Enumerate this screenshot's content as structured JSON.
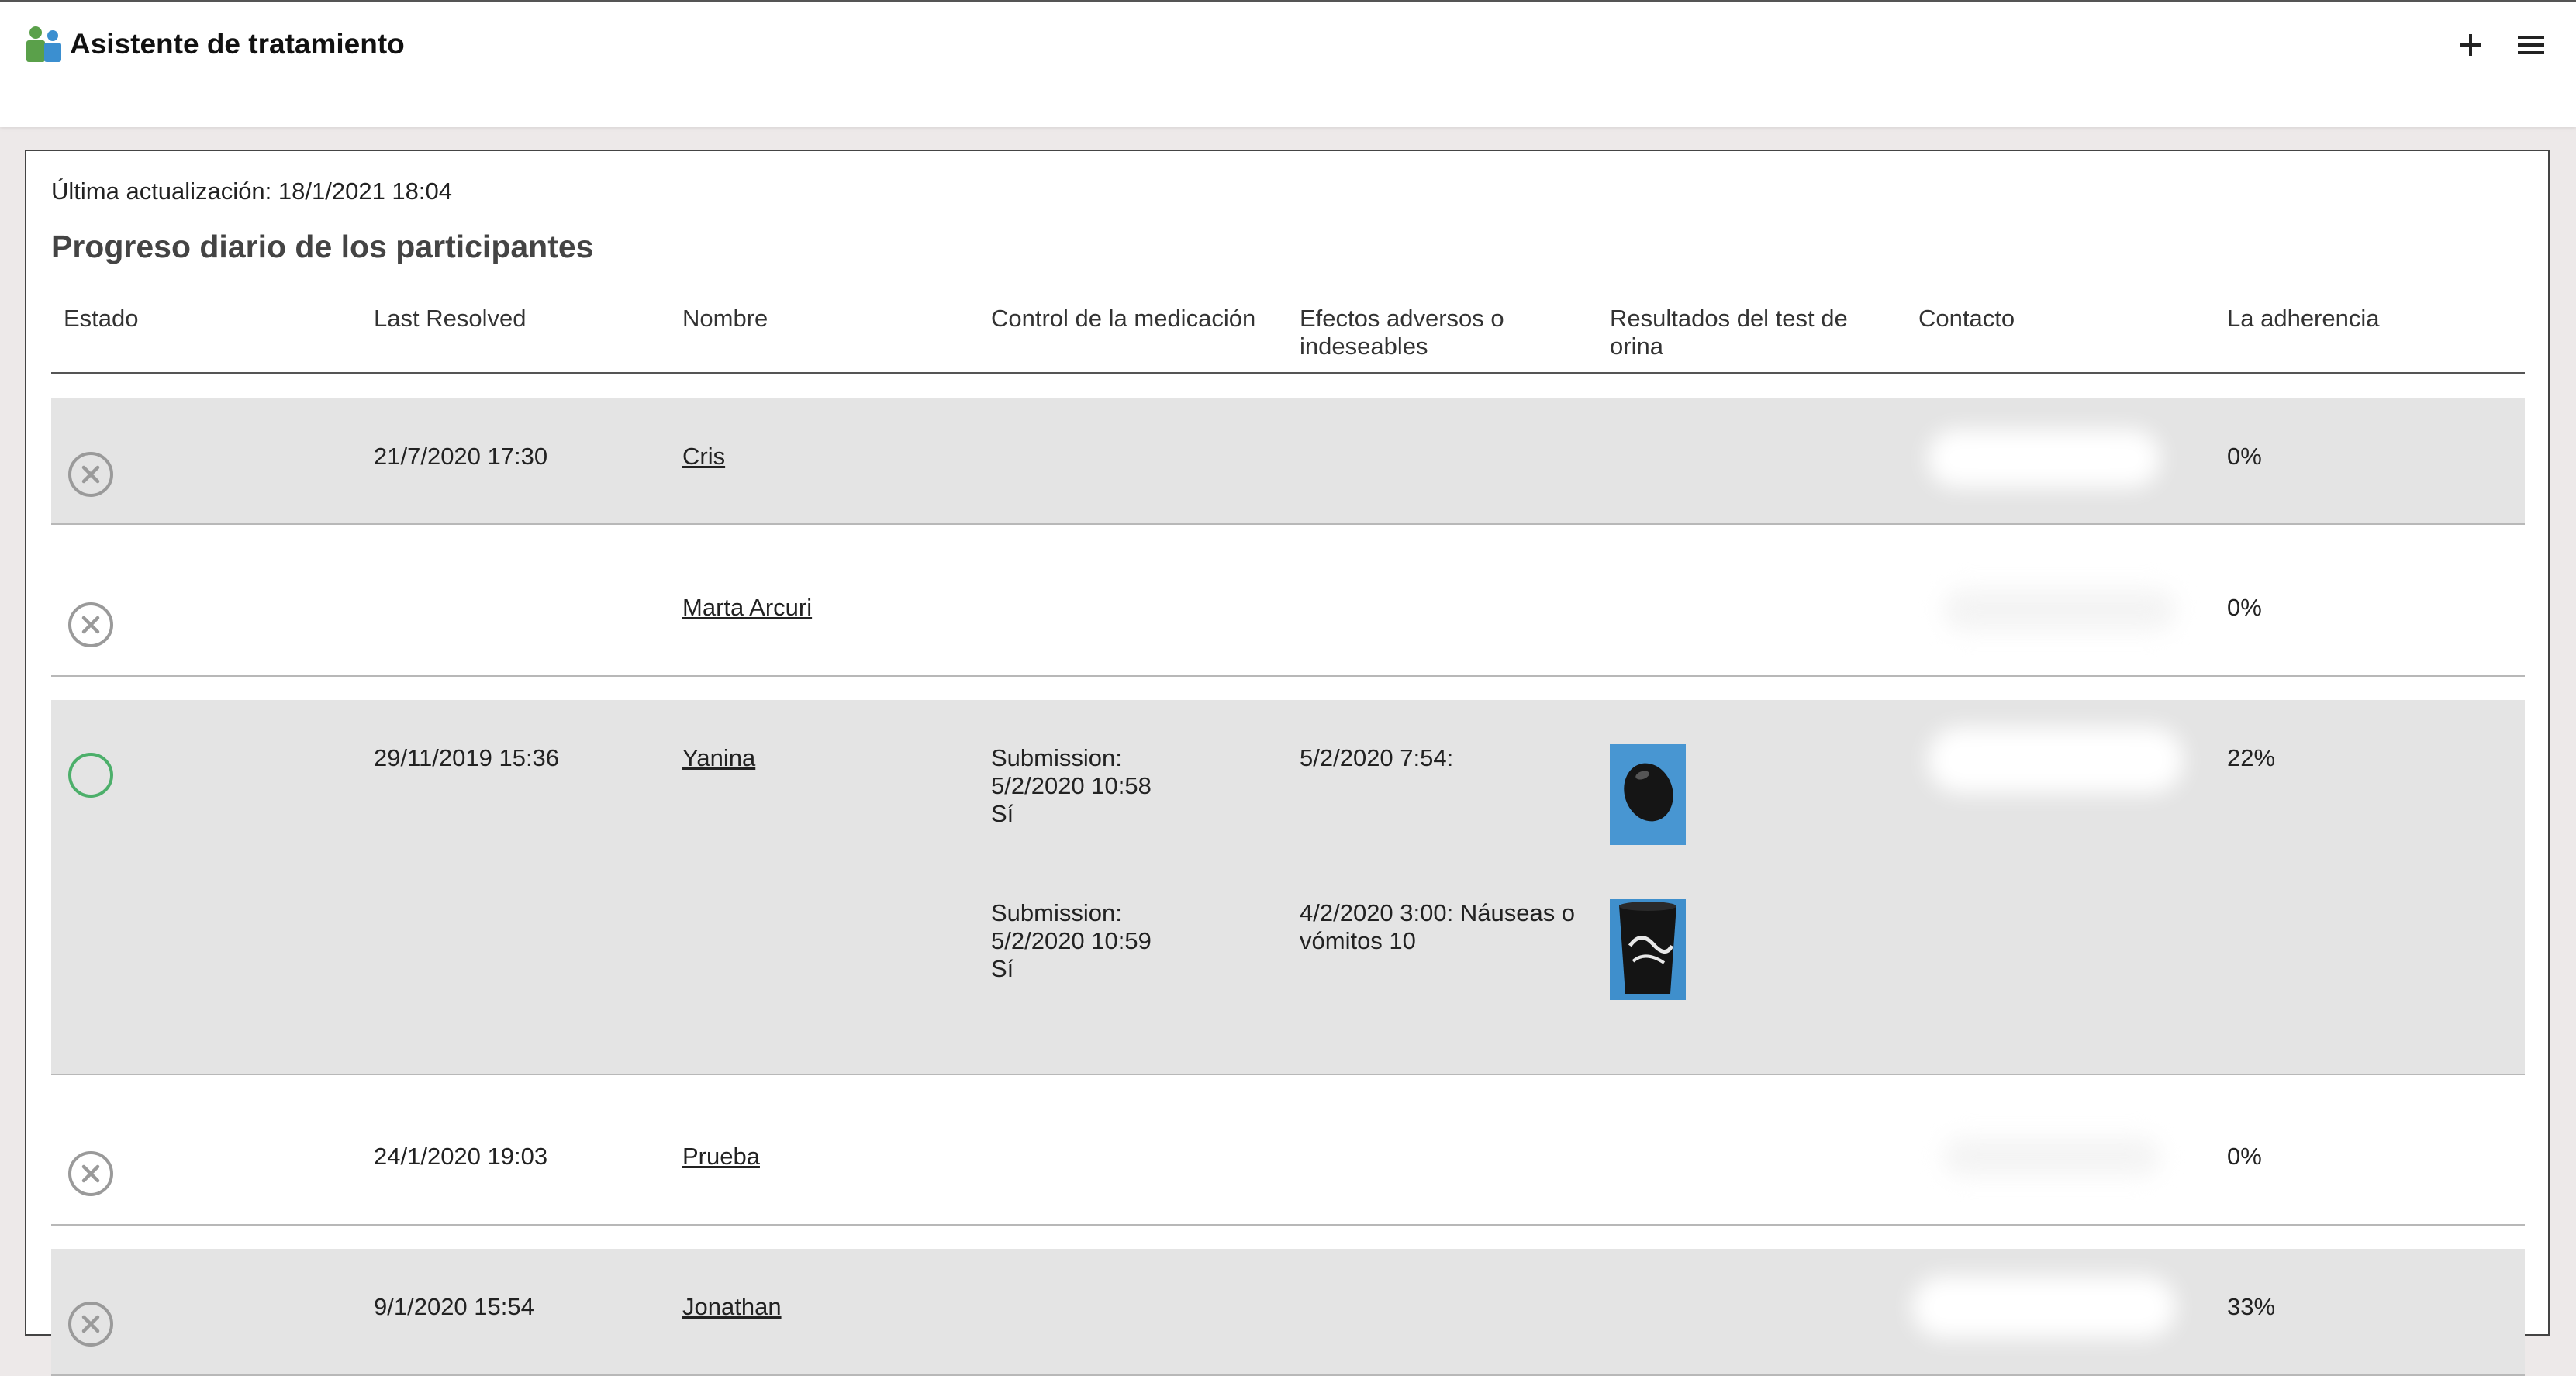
{
  "app": {
    "title": "Asistente de tratamiento"
  },
  "toolbar": {
    "add_icon": "plus-icon",
    "menu_icon": "hamburger-menu-icon"
  },
  "main": {
    "last_updated": "Última actualización: 18/1/2021 18:04",
    "section_title": "Progreso diario de los participantes",
    "columns": [
      "Estado",
      "Last Resolved",
      "Nombre",
      "Control de la medicación",
      "Efectos adversos o indeseables",
      "Resultados del test de orina",
      "Contacto",
      "La adherencia"
    ],
    "rows": [
      {
        "status": "x-circle-icon",
        "last_resolved": "21/7/2020 17:30",
        "name": "Cris",
        "adherence": "0%"
      },
      {
        "status": "x-circle-icon",
        "last_resolved": "",
        "name": "Marta Arcuri",
        "adherence": "0%"
      },
      {
        "status": "circle-icon",
        "last_resolved": "29/11/2019 15:36",
        "name": "Yanina",
        "adherence": "22%",
        "entries": [
          {
            "medication": [
              "Submission:",
              "5/2/2020 10:58",
              "Sí"
            ],
            "adverse": "5/2/2020 7:54:"
          },
          {
            "medication": [
              "Submission:",
              "5/2/2020 10:59",
              "Sí"
            ],
            "adverse": "4/2/2020 3:00: Náuseas o vómitos 10"
          }
        ]
      },
      {
        "status": "x-circle-icon",
        "last_resolved": "24/1/2020 19:03",
        "name": "Prueba",
        "adherence": "0%"
      },
      {
        "status": "x-circle-icon",
        "last_resolved": "9/1/2020 15:54",
        "name": "Jonathan",
        "adherence": "33%"
      }
    ]
  },
  "colors": {
    "ok": "#4caf6a",
    "failed": "#9a9a9a",
    "row_alt": "#e4e4e4"
  }
}
